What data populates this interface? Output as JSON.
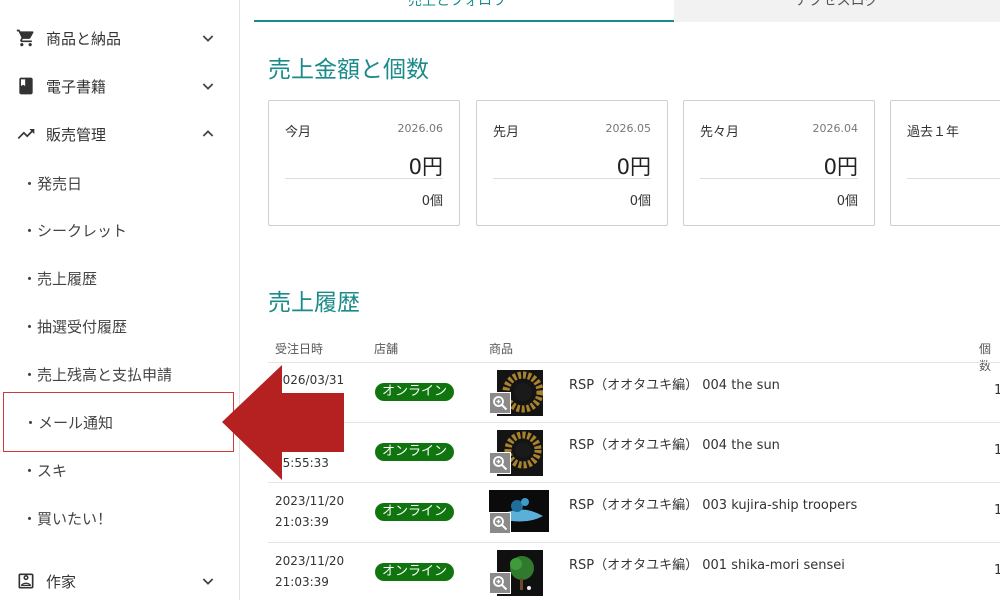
{
  "sidebar": {
    "sections": [
      {
        "label": "商品と納品",
        "icon": "cart-icon",
        "expanded": false
      },
      {
        "label": "電子書籍",
        "icon": "book-icon",
        "expanded": false
      },
      {
        "label": "販売管理",
        "icon": "trending-up-icon",
        "expanded": true
      },
      {
        "label": "作家",
        "icon": "account-box-icon",
        "expanded": false
      }
    ],
    "sub_items": [
      {
        "label": "・発売日"
      },
      {
        "label": "・シークレット"
      },
      {
        "label": "・売上履歴"
      },
      {
        "label": "・抽選受付履歴"
      },
      {
        "label": "・売上残高と支払申請"
      },
      {
        "label": "・メール通知",
        "highlighted": true
      },
      {
        "label": "・スキ"
      },
      {
        "label": "・買いたい！"
      }
    ]
  },
  "tabs": [
    {
      "label": "売上とフォロワー",
      "active": true
    },
    {
      "label": "アクセスログ",
      "active": false
    }
  ],
  "sales_summary": {
    "title": "売上金額と個数",
    "cards": [
      {
        "label": "今月",
        "date": "2026.06",
        "amount": "0円",
        "count": "0個"
      },
      {
        "label": "先月",
        "date": "2026.05",
        "amount": "0円",
        "count": "0個"
      },
      {
        "label": "先々月",
        "date": "2026.04",
        "amount": "0円",
        "count": "0個"
      },
      {
        "label": "過去１年",
        "date": "",
        "amount": "",
        "count": ""
      }
    ]
  },
  "history": {
    "title": "売上履歴",
    "headers": {
      "date": "受注日時",
      "shop": "店舗",
      "product": "商品",
      "qty": "個数"
    },
    "rows": [
      {
        "date": "2026/03/31",
        "time": "",
        "shop": "オンライン",
        "product": "RSP（オオタユキ編） 004 the sun",
        "qty": "1",
        "thumb": "sun"
      },
      {
        "date": "",
        "time": "15:55:33",
        "shop": "オンライン",
        "product": "RSP（オオタユキ編） 004 the sun",
        "qty": "1",
        "thumb": "sun"
      },
      {
        "date": "2023/11/20",
        "time": "21:03:39",
        "shop": "オンライン",
        "product": "RSP（オオタユキ編） 003 kujira-ship troopers",
        "qty": "1",
        "thumb": "whale"
      },
      {
        "date": "2023/11/20",
        "time": "21:03:39",
        "shop": "オンライン",
        "product": "RSP（オオタユキ編） 001 shika-mori sensei",
        "qty": "1",
        "thumb": "tree"
      }
    ]
  },
  "colors": {
    "accent": "#1a8a8a",
    "badge": "#10750f",
    "highlight_border": "#d23a3a",
    "arrow": "#b52020"
  }
}
